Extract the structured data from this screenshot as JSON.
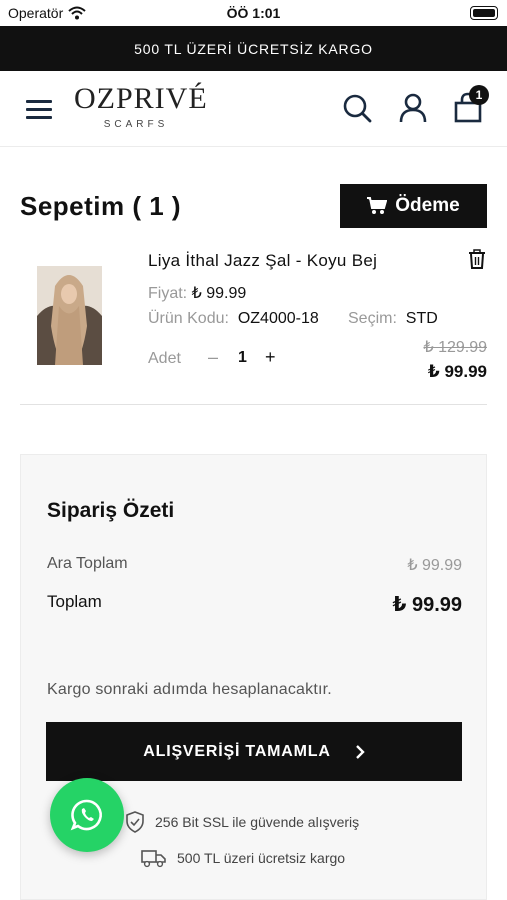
{
  "status_bar": {
    "carrier": "Operatör",
    "time": "ÖÖ 1:01"
  },
  "promo": {
    "text": "500 TL ÜZERİ ÜCRETSİZ KARGO"
  },
  "header": {
    "logo_main": "OZPRIVÉ",
    "logo_sub": "SCARFS",
    "cart_count": "1"
  },
  "cart": {
    "title": "Sepetim ( 1 )",
    "checkout_label": "Ödeme",
    "item": {
      "name": "Liya İthal Jazz Şal - Koyu Bej",
      "price_label": "Fiyat:",
      "price": "₺ 99.99",
      "code_label": "Ürün Kodu:",
      "code": "OZ4000-18",
      "selection_label": "Seçim:",
      "selection": "STD",
      "qty_label": "Adet",
      "qty_minus": "–",
      "qty": "1",
      "qty_plus": "+",
      "old_price": "₺ 129.99",
      "new_price": "₺ 99.99"
    }
  },
  "summary": {
    "title": "Sipariş Özeti",
    "subtotal_label": "Ara Toplam",
    "subtotal": "₺ 99.99",
    "total_label": "Toplam",
    "total": "₺ 99.99",
    "shipping_note": "Kargo sonraki adımda hesaplanacaktır.",
    "complete_button": "ALIŞVERİŞİ TAMAMLA",
    "trust_ssl": "256 Bit SSL ile güvende alışveriş",
    "trust_shipping": "500 TL üzeri ücretsiz kargo"
  },
  "colors": {
    "dark": "#111111",
    "whatsapp": "#25d366",
    "muted": "#999999"
  }
}
